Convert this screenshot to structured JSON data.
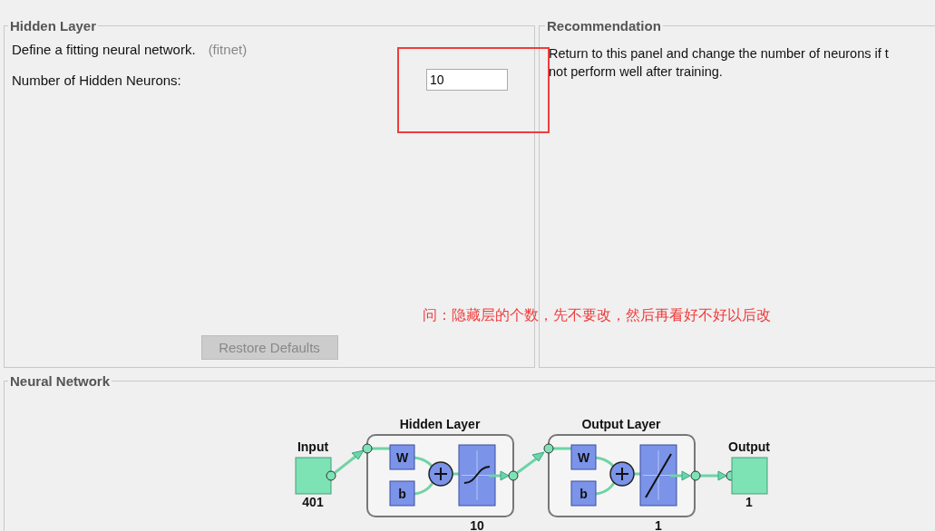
{
  "hidden_layer": {
    "title": "Hidden Layer",
    "description": "Define a fitting neural network.",
    "function_name": "(fitnet)",
    "neurons_label": "Number of Hidden Neurons:",
    "neurons_value": "10",
    "restore_button": {
      "label": "Restore Defaults",
      "disabled": true
    }
  },
  "recommendation": {
    "title": "Recommendation",
    "lines": [
      "Return to this panel and change the number of neurons if t",
      "not perform well after training."
    ]
  },
  "annotation": {
    "text": "问：隐藏层的个数，先不要改，然后再看好不好以后改"
  },
  "neural_network": {
    "title": "Neural Network",
    "input": {
      "label": "Input",
      "size": "401"
    },
    "layers": [
      {
        "title": "Hidden Layer",
        "weight": "W",
        "bias": "b",
        "kind": "sigmoid",
        "size": "10"
      },
      {
        "title": "Output Layer",
        "weight": "W",
        "bias": "b",
        "kind": "linear",
        "size": "1"
      }
    ],
    "output": {
      "label": "Output",
      "size": "1"
    }
  }
}
